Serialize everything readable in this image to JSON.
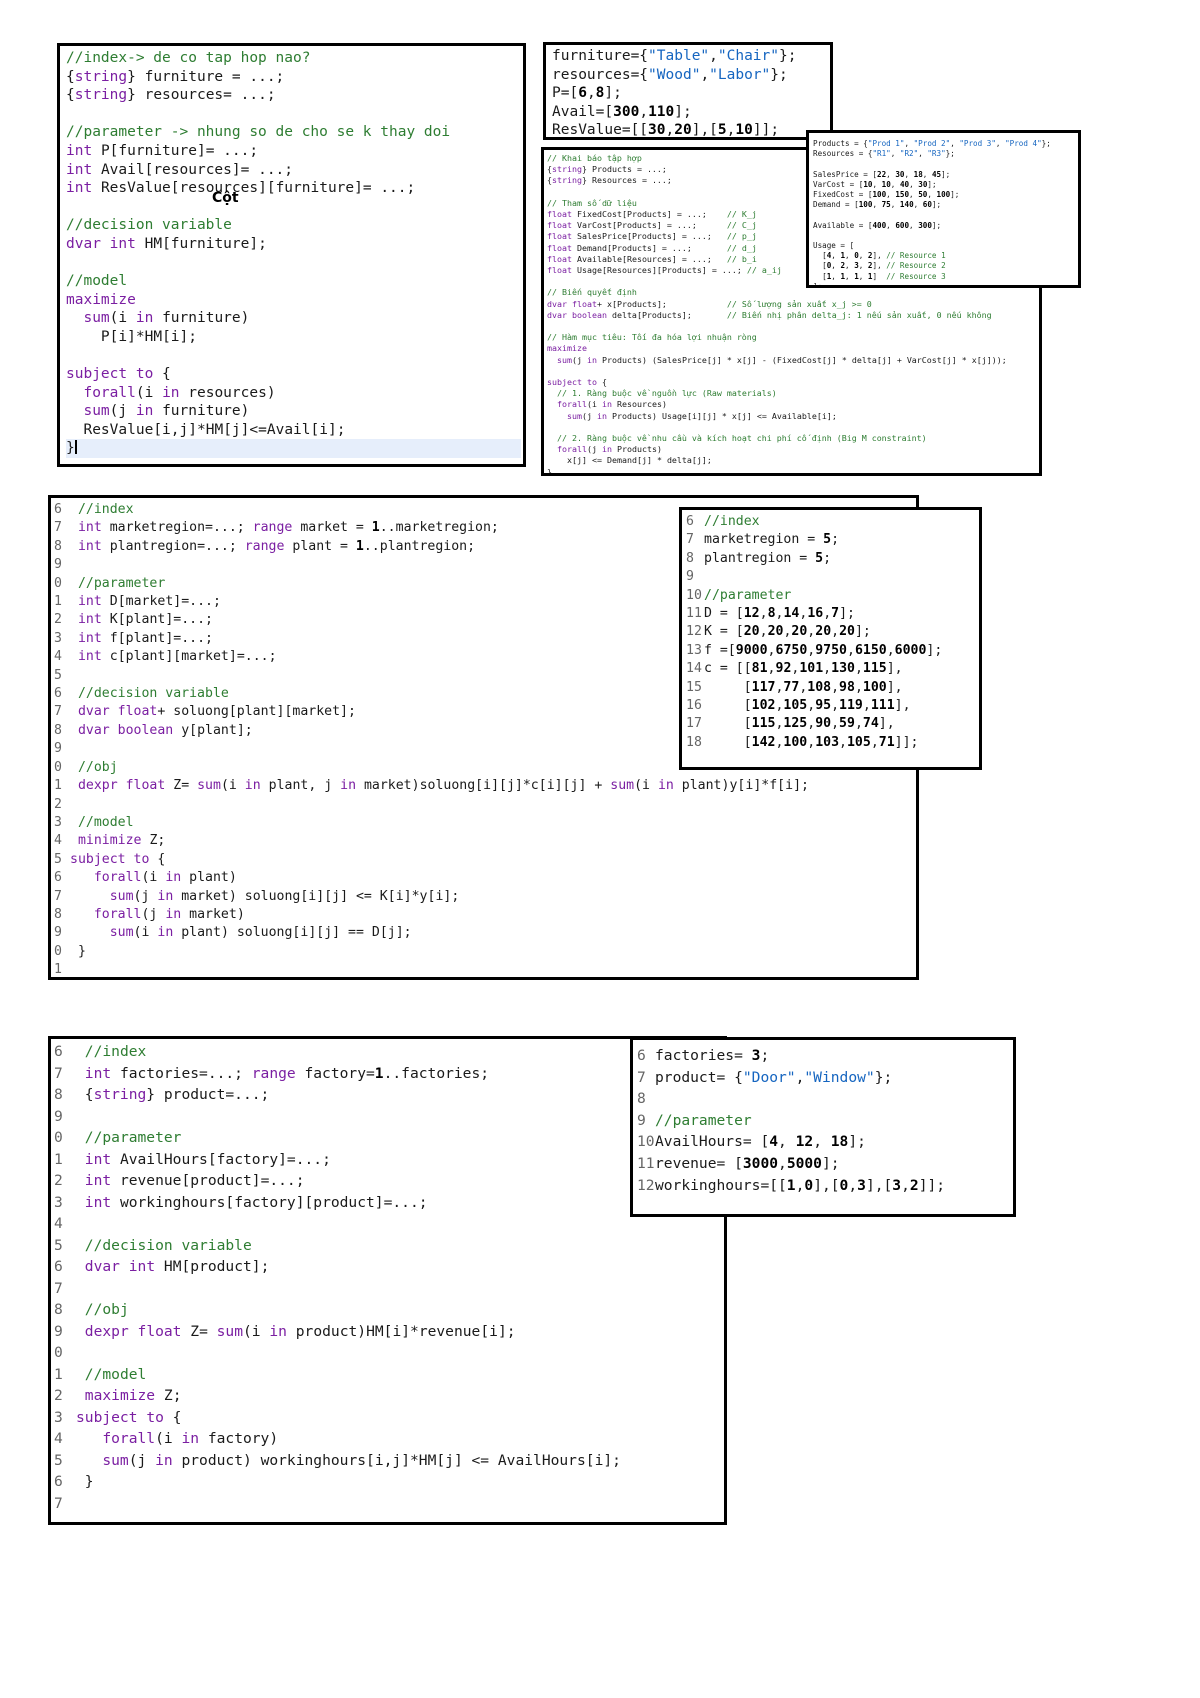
{
  "panel1": {
    "lines": [
      "//index-> de co tap hop nao?",
      "{string} furniture = ...;",
      "{string} resources= ...;",
      "",
      "//parameter -> nhung so de cho se k thay doi",
      "int P[furniture]= ...;",
      "int Avail[resources]= ...;",
      "int ResValue[resources][furniture]= ...;",
      "",
      "//decision variable",
      "dvar int HM[furniture];",
      "",
      "//model",
      "maximize",
      "  sum(i in furniture)",
      "    P[i]*HM[i];",
      "",
      "subject to {",
      "  forall(i in resources)",
      "  sum(j in furniture)",
      "  ResValue[i,j]*HM[j]<=Avail[i];",
      "}"
    ],
    "annotation": "Cột"
  },
  "panel2": {
    "lines": [
      "furniture={\"Table\",\"Chair\"};",
      "resources={\"Wood\",\"Labor\"};",
      "P=[6,8];",
      "Avail=[300,110];",
      "ResValue=[[30,20],[5,10]];"
    ]
  },
  "panel3": {
    "lines": [
      "// Khai báo tập hợp",
      "{string} Products = ...;",
      "{string} Resources = ...;",
      "",
      "// Tham số dữ liệu",
      "float FixedCost[Products] = ...;    // K_j",
      "float VarCost[Products] = ...;      // C_j",
      "float SalesPrice[Products] = ...;   // p_j",
      "float Demand[Products] = ...;       // d_j",
      "float Available[Resources] = ...;   // b_i",
      "float Usage[Resources][Products] = ...; // a_ij",
      "",
      "// Biến quyết định",
      "dvar float+ x[Products];            // Số lượng sản xuất x_j >= 0",
      "dvar boolean delta[Products];       // Biến nhị phân delta_j: 1 nếu sản xuất, 0 nếu không",
      "",
      "// Hàm mục tiêu: Tối đa hóa lợi nhuận ròng",
      "maximize",
      "  sum(j in Products) (SalesPrice[j] * x[j] - (FixedCost[j] * delta[j] + VarCost[j] * x[j]));",
      "",
      "subject to {",
      "  // 1. Ràng buộc về nguồn lực (Raw materials)",
      "  forall(i in Resources)",
      "    sum(j in Products) Usage[i][j] * x[j] <= Available[i];",
      "",
      "  // 2. Ràng buộc về nhu cầu và kích hoạt chi phí cố định (Big M constraint)",
      "  forall(j in Products)",
      "    x[j] <= Demand[j] * delta[j];",
      "}"
    ]
  },
  "panel4": {
    "lines": [
      "Products = {\"Prod 1\", \"Prod 2\", \"Prod 3\", \"Prod 4\"};",
      "Resources = {\"R1\", \"R2\", \"R3\"};",
      "",
      "SalesPrice = [22, 30, 18, 45];",
      "VarCost = [10, 10, 40, 30];",
      "FixedCost = [100, 150, 50, 100];",
      "Demand = [100, 75, 140, 60];",
      "",
      "Available = [400, 600, 300];",
      "",
      "Usage = [",
      "  [4, 1, 0, 2], // Resource 1",
      "  [0, 2, 3, 2], // Resource 2",
      "  [1, 1, 1, 1]  // Resource 3",
      "];"
    ]
  },
  "panel5": {
    "line_numbers": [
      "6",
      "7",
      "8",
      "9",
      "0",
      "1",
      "2",
      "3",
      "4",
      "5",
      "6",
      "7",
      "8",
      "9",
      "0",
      "1",
      "2",
      "3",
      "4",
      "5",
      "6",
      "7",
      "8",
      "9",
      "0",
      "1"
    ],
    "lines": [
      " //index",
      " int marketregion=...; range market = 1..marketregion;",
      " int plantregion=...; range plant = 1..plantregion;",
      "",
      " //parameter",
      " int D[market]=...;",
      " int K[plant]=...;",
      " int f[plant]=...;",
      " int c[plant][market]=...;",
      "",
      " //decision variable",
      " dvar float+ soluong[plant][market];",
      " dvar boolean y[plant];",
      "",
      " //obj",
      " dexpr float Z= sum(i in plant, j in market)soluong[i][j]*c[i][j] + sum(i in plant)y[i]*f[i];",
      "",
      " //model",
      " minimize Z;",
      "subject to {",
      "   forall(i in plant)",
      "     sum(j in market) soluong[i][j] <= K[i]*y[i];",
      "   forall(j in market)",
      "     sum(i in plant) soluong[i][j] == D[j];",
      " }",
      ""
    ]
  },
  "panel6": {
    "line_numbers": [
      "6",
      "7",
      "8",
      "9",
      "10",
      "11",
      "12",
      "13",
      "14",
      "15",
      "16",
      "17",
      "18"
    ],
    "lines": [
      "//index",
      "marketregion = 5;",
      "plantregion = 5;",
      "",
      "//parameter",
      "D = [12,8,14,16,7];",
      "K = [20,20,20,20,20];",
      "f =[9000,6750,9750,6150,6000];",
      "c = [[81,92,101,130,115],",
      "     [117,77,108,98,100],",
      "     [102,105,95,119,111],",
      "     [115,125,90,59,74],",
      "     [142,100,103,105,71]];"
    ]
  },
  "panel7": {
    "line_numbers": [
      "6",
      "7",
      "8",
      "9",
      "0",
      "1",
      "2",
      "3",
      "4",
      "5",
      "6",
      "7",
      "8",
      "9",
      "0",
      "1",
      "2",
      "3",
      "4",
      "5",
      "6",
      "7"
    ],
    "lines": [
      " //index",
      " int factories=...; range factory=1..factories;",
      " {string} product=...;",
      "",
      " //parameter",
      " int AvailHours[factory]=...;",
      " int revenue[product]=...;",
      " int workinghours[factory][product]=...;",
      "",
      " //decision variable",
      " dvar int HM[product];",
      "",
      " //obj",
      " dexpr float Z= sum(i in product)HM[i]*revenue[i];",
      "",
      " //model",
      " maximize Z;",
      "subject to {",
      "   forall(i in factory)",
      "   sum(j in product) workinghours[i,j]*HM[j] <= AvailHours[i];",
      " }",
      ""
    ]
  },
  "panel8": {
    "line_numbers": [
      "6",
      "7",
      "8",
      "9",
      "10",
      "11",
      "12"
    ],
    "lines": [
      "factories= 3;",
      "product= {\"Door\",\"Window\"};",
      "",
      "//parameter",
      "AvailHours= [4, 12, 18];",
      "revenue= [3000,5000];",
      "workinghours=[[1,0],[0,3],[3,2]];"
    ]
  }
}
